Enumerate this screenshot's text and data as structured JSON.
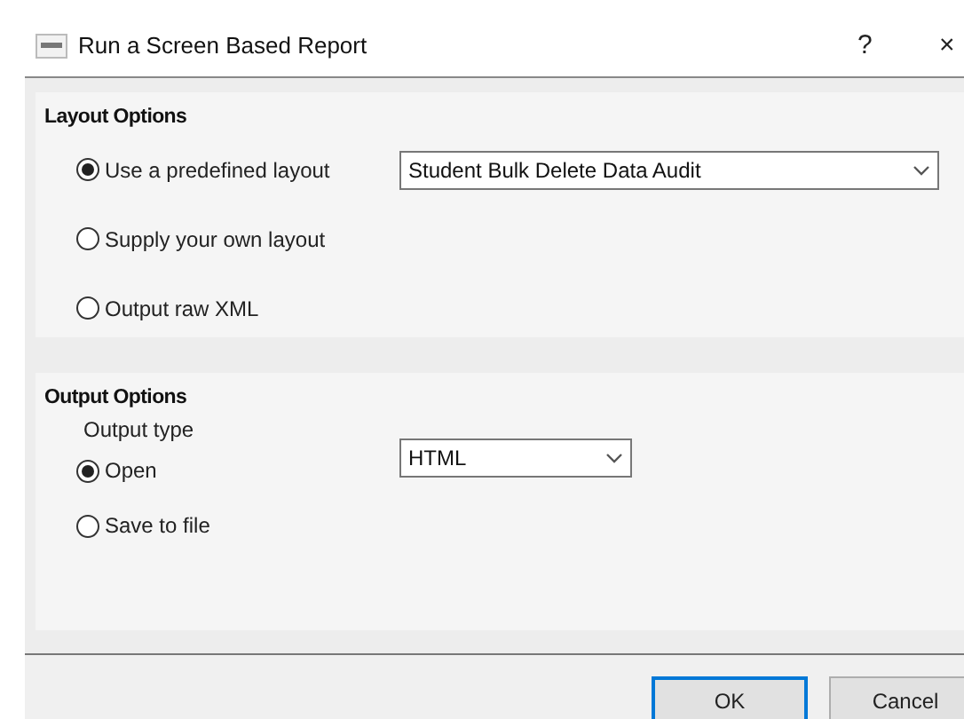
{
  "window": {
    "title": "Run a Screen Based Report",
    "help": "?",
    "close": "×"
  },
  "layout_options": {
    "heading": "Layout Options",
    "options": [
      {
        "label": "Use a predefined layout",
        "selected": true,
        "dropdown": "Student Bulk Delete Data Audit"
      },
      {
        "label": "Supply your own layout",
        "selected": false
      },
      {
        "label": "Output raw XML",
        "selected": false
      }
    ]
  },
  "output_options": {
    "heading": "Output Options",
    "type_label": "Output type",
    "dropdown": "HTML",
    "options": [
      {
        "label": "Open",
        "selected": true
      },
      {
        "label": "Save to file",
        "selected": false
      }
    ]
  },
  "buttons": [
    {
      "label": "OK",
      "default": true
    },
    {
      "label": "Cancel",
      "default": false
    }
  ]
}
